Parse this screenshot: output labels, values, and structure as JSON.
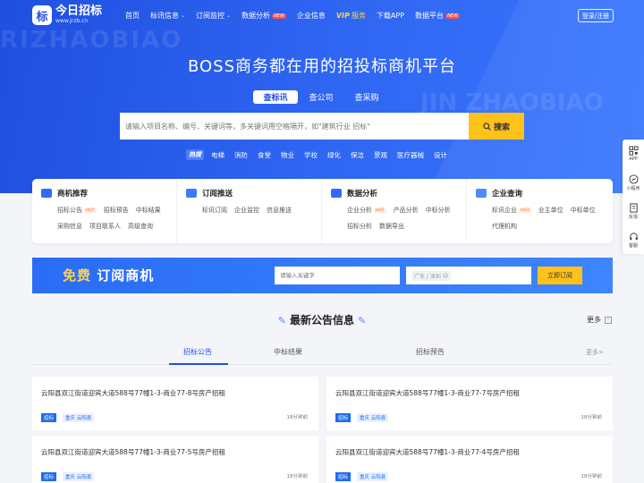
{
  "brand": {
    "logo_char": "标",
    "name": "今日招标",
    "url": "www.jrzb.cn"
  },
  "nav": {
    "items": [
      {
        "label": "首页",
        "dropdown": false,
        "badge": ""
      },
      {
        "label": "标讯信息",
        "dropdown": true,
        "badge": ""
      },
      {
        "label": "订阅监控",
        "dropdown": true,
        "badge": ""
      },
      {
        "label": "数据分析",
        "dropdown": false,
        "badge": "NEW"
      },
      {
        "label": "企业信息",
        "dropdown": false,
        "badge": ""
      }
    ],
    "vip_mark": "VIP",
    "vip_label": "服务",
    "download_label": "下载APP",
    "platform_label": "数据平台",
    "platform_badge": "NEW",
    "login_label": "登录/注册"
  },
  "hero": {
    "watermark": "RIZHAOBIAO",
    "watermark2": "JIN ZHAOBIAO",
    "slogan": "BOSS商务都在用的招投标商机平台",
    "search_tabs": [
      "查标讯",
      "查公司",
      "查采购"
    ],
    "search_placeholder": "请输入项目名称、编号、关键词等，多关键词用空格隔开，如\"建筑行业 招标\"",
    "search_button": "搜索",
    "hot_tag": "热搜",
    "hot_words": [
      "电梯",
      "消防",
      "食堂",
      "物业",
      "学校",
      "绿化",
      "保洁",
      "景观",
      "医疗器械",
      "设计"
    ]
  },
  "categories": [
    {
      "title": "商机推荐",
      "icon_color": "#2f6bff",
      "links": [
        {
          "label": "招标公告",
          "badge": "HOT"
        },
        {
          "label": "招标预告",
          "badge": ""
        },
        {
          "label": "中标结果",
          "badge": ""
        },
        {
          "label": "采购信息",
          "badge": ""
        },
        {
          "label": "项目联系人",
          "badge": ""
        },
        {
          "label": "高级查询",
          "badge": ""
        }
      ]
    },
    {
      "title": "订阅推送",
      "icon_color": "#3a7bff",
      "links": [
        {
          "label": "标讯订阅",
          "badge": ""
        },
        {
          "label": "企业监控",
          "badge": ""
        },
        {
          "label": "信息推送",
          "badge": ""
        }
      ]
    },
    {
      "title": "数据分析",
      "icon_color": "#2f6bff",
      "links": [
        {
          "label": "企业分析",
          "badge": "HOT"
        },
        {
          "label": "产品分析",
          "badge": ""
        },
        {
          "label": "中标分析",
          "badge": ""
        },
        {
          "label": "招标分析",
          "badge": ""
        },
        {
          "label": "数据导出",
          "badge": ""
        }
      ]
    },
    {
      "title": "企业查询",
      "icon_color": "#4a8bff",
      "links": [
        {
          "label": "标讯企业",
          "badge": "HOT"
        },
        {
          "label": "业主单位",
          "badge": ""
        },
        {
          "label": "中标单位",
          "badge": ""
        },
        {
          "label": "代理机构",
          "badge": ""
        }
      ]
    }
  ],
  "banner": {
    "title_free": "免费",
    "title_rest": " 订阅商机",
    "keyword_placeholder": "请输入关键字",
    "region_chip": "广东 / 深圳",
    "subscribe_button": "立即订阅"
  },
  "section": {
    "title": "最新公告信息",
    "more": "更多",
    "tabs": [
      "招标公告",
      "中标结果",
      "招标预告"
    ],
    "tabs_more": "更多>",
    "cards": [
      {
        "title": "云阳县双江街道迎宾大道588号77幢1-3-商业77-8号房产招租",
        "tag": "招标",
        "region": "重庆 云阳县",
        "time": "18分钟前"
      },
      {
        "title": "云阳县双江街道迎宾大道588号77幢1-3-商业77-7号房产招租",
        "tag": "招标",
        "region": "重庆 云阳县",
        "time": "18分钟前"
      },
      {
        "title": "云阳县双江街道迎宾大道588号77幢1-3-商业77-5号房产招租",
        "tag": "招标",
        "region": "重庆 云阳县",
        "time": "18分钟前"
      },
      {
        "title": "云阳县双江街道迎宾大道588号77幢1-3-商业77-4号房产招租",
        "tag": "招标",
        "region": "重庆 云阳县",
        "time": "18分钟前"
      }
    ]
  },
  "sidebar": {
    "items": [
      {
        "label": "APP",
        "icon": "qrcode-icon"
      },
      {
        "label": "小程序",
        "icon": "miniprogram-icon"
      },
      {
        "label": "反馈",
        "icon": "feedback-icon"
      },
      {
        "label": "客服",
        "icon": "headset-icon"
      }
    ]
  },
  "colors": {
    "primary": "#1f4fe0",
    "accent": "#ffc21a",
    "new": "#ff4d4f"
  }
}
